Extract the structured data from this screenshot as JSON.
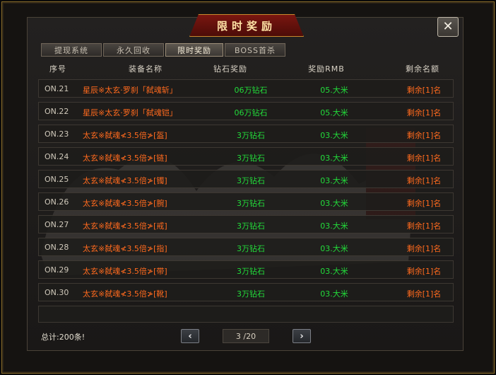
{
  "window": {
    "title": "限时奖励",
    "close_glyph": "✕"
  },
  "tabs": [
    {
      "label": "提现系统",
      "active": false
    },
    {
      "label": "永久回收",
      "active": false
    },
    {
      "label": "限时奖励",
      "active": true
    },
    {
      "label": "BOSS首杀",
      "active": false
    }
  ],
  "table": {
    "headers": [
      "序号",
      "装备名称",
      "钻石奖励",
      "奖励RMB",
      "剩余名额"
    ],
    "rows": [
      {
        "no": "ON.21",
        "name": "星辰※太玄·罗刹「弑魂斩」",
        "diamond": "06万钻石",
        "rmb": "05.大米",
        "remaining": "剩余[1]名"
      },
      {
        "no": "ON.22",
        "name": "星辰※太玄·罗刹「弑魂铠」",
        "diamond": "06万钻石",
        "rmb": "05.大米",
        "remaining": "剩余[1]名"
      },
      {
        "no": "ON.23",
        "name": "太玄※弑魂≮3.5倍≯[盔]",
        "diamond": "3万钻石",
        "rmb": "03.大米",
        "remaining": "剩余[1]名"
      },
      {
        "no": "ON.24",
        "name": "太玄※弑魂≮3.5倍≯[链]",
        "diamond": "3万钻石",
        "rmb": "03.大米",
        "remaining": "剩余[1]名"
      },
      {
        "no": "ON.25",
        "name": "太玄※弑魂≮3.5倍≯[镯]",
        "diamond": "3万钻石",
        "rmb": "03.大米",
        "remaining": "剩余[1]名"
      },
      {
        "no": "ON.26",
        "name": "太玄※弑魂≮3.5倍≯[腕]",
        "diamond": "3万钻石",
        "rmb": "03.大米",
        "remaining": "剩余[1]名"
      },
      {
        "no": "ON.27",
        "name": "太玄※弑魂≮3.5倍≯[戒]",
        "diamond": "3万钻石",
        "rmb": "03.大米",
        "remaining": "剩余[1]名"
      },
      {
        "no": "ON.28",
        "name": "太玄※弑魂≮3.5倍≯[指]",
        "diamond": "3万钻石",
        "rmb": "03.大米",
        "remaining": "剩余[1]名"
      },
      {
        "no": "ON.29",
        "name": "太玄※弑魂≮3.5倍≯[带]",
        "diamond": "3万钻石",
        "rmb": "03.大米",
        "remaining": "剩余[1]名"
      },
      {
        "no": "ON.30",
        "name": "太玄※弑魂≮3.5倍≯[靴]",
        "diamond": "3万钻石",
        "rmb": "03.大米",
        "remaining": "剩余[1]名"
      }
    ]
  },
  "footer": {
    "total": "总计:200条!",
    "prev_glyph": "‹",
    "next_glyph": "›",
    "page": "3 /20"
  },
  "icons": {
    "close": "close-icon",
    "prev": "chevron-left-icon",
    "next": "chevron-right-icon"
  },
  "colors": {
    "name_text": "#ff6a1e",
    "reward_text": "#22dc3a",
    "title_plate": "#7a1610",
    "gold_border": "#c8892e"
  }
}
